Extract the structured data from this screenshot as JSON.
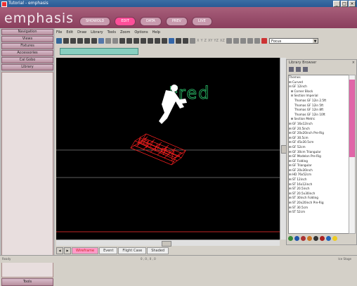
{
  "window": {
    "title": "Tutorial - emphasis",
    "controls": [
      "_",
      "□",
      "×"
    ]
  },
  "app": {
    "logo": "emphasis"
  },
  "mode_tabs": [
    {
      "label": "SHOWOLD",
      "active": false
    },
    {
      "label": "EDIT",
      "active": true
    },
    {
      "label": "DATA",
      "active": false
    },
    {
      "label": "PREV",
      "active": false
    },
    {
      "label": "LIVE",
      "active": false
    }
  ],
  "sidebar": {
    "items": [
      "Navigation",
      "Views",
      "Fixtures",
      "Accessories",
      "Cal Gobo",
      "Library"
    ],
    "bottom": "Tools"
  },
  "menubar": [
    "File",
    "Edit",
    "Draw",
    "Library",
    "Tools",
    "Zoom",
    "Options",
    "Help"
  ],
  "toolbar": {
    "icon_colors": [
      "#336699",
      "#444444",
      "#444444",
      "#444444",
      "#444444",
      "#444444",
      "#5577aa",
      "#888888",
      "#888888",
      "#444444",
      "#444444",
      "#444444",
      "#444444",
      "#444444",
      "#444444",
      "#444444",
      "#3366aa",
      "#444444",
      "#444444",
      "#888888",
      "#888888",
      "#888888",
      "#888888",
      "#888888",
      "#888888",
      "#cc3333"
    ],
    "axis_labels": [
      "X",
      "Y",
      "Z",
      "XY",
      "YZ",
      "XZ"
    ],
    "focus_value": "Focus"
  },
  "viewport": {
    "label_text": "Fred",
    "label_color": "#2ecc71",
    "figure_color": "#ffffff",
    "truss_color": "#ff2020",
    "floor_line_color": "#ff3030"
  },
  "view_tabs": [
    {
      "label": "Wireframe",
      "active": true
    },
    {
      "label": "Event",
      "active": false
    },
    {
      "label": "Flight Case",
      "active": false
    },
    {
      "label": "Shaded",
      "active": false
    }
  ],
  "status": {
    "left": "Ready",
    "center": "0 , 0 , 0 , 0",
    "right": "Ice Stage"
  },
  "library": {
    "title": "Library Browser",
    "tree": [
      "Themes",
      "⊞ Curved",
      "⊟ GF 12inch",
      "  ⊞ Corner Block",
      "  ⊟ Section Imperial",
      "      Thomas GF 12in 2.5ft",
      "      Thomas GF 12in 5ft",
      "      Thomas GF 12in 8ft",
      "      Thomas GF 12in 10ft",
      "  ⊞ Section Metric",
      "⊞ GF 16x12inch",
      "⊞ GF 20.5inch",
      "⊞ GF 20x20inch Pre-Rig",
      "⊞ GF 30.5cm",
      "⊞ GF 45x30.5cm",
      "⊞ GF 52cm",
      "⊞ GF 30cm Triangular",
      "⊞ GF Modelon Pre-Rig",
      "⊞ GF Folding",
      "⊞ GF Triangular",
      "⊞ GF 20x30inch",
      "⊞ HD 76x52cm",
      "⊞ ST 12inch",
      "⊞ ST 16x12inch",
      "⊞ ST 20.5inch",
      "⊞ ST 20.5x30inch",
      "⊞ ST 30inch Folding",
      "⊞ ST 20x20inch Pre-Rig",
      "⊞ ST 30.5cm",
      "⊞ ST 52cm"
    ],
    "bottom_icon_colors": [
      "#3a8a3a",
      "#2255aa",
      "#aa3333",
      "#cc7722",
      "#333333",
      "#aa2222",
      "#2266bb",
      "#eecc22"
    ]
  }
}
